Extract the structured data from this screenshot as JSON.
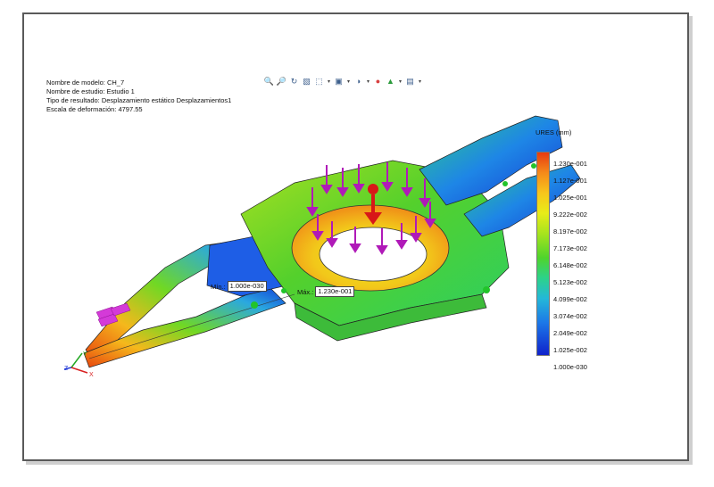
{
  "info": {
    "model_name": "Nombre de modelo: CH_7",
    "study_name": "Nombre de estudio: Estudio 1",
    "result_type": "Tipo de resultado: Desplazamiento estático Desplazamientos1",
    "deformation_scale": "Escala de deformación: 4797.55"
  },
  "toolbar": {
    "icons": [
      "zoom-fit-icon",
      "zoom-area-icon",
      "rotate-icon",
      "section-view-icon",
      "view-orientation-icon",
      "display-style-icon",
      "hide-show-icon",
      "edit-appearance-icon",
      "scene-icon",
      "view-settings-icon"
    ]
  },
  "legend": {
    "title": "URES (mm)",
    "labels": [
      "1.230e-001",
      "1.127e-001",
      "1.025e-001",
      "9.222e-002",
      "8.197e-002",
      "7.173e-002",
      "6.148e-002",
      "5.123e-002",
      "4.099e-002",
      "3.074e-002",
      "2.049e-002",
      "1.025e-002",
      "1.000e-030"
    ],
    "colors": {
      "max": "#e83a10",
      "mid": "#4fd42c",
      "min": "#1022cc"
    }
  },
  "probes": {
    "min_label": "Mín.:",
    "min_value": "1.000e-030",
    "max_label": "Máx.:",
    "max_value": "1.230e-001"
  },
  "triad": {
    "x": "X",
    "y": "Y",
    "z": "Z"
  }
}
